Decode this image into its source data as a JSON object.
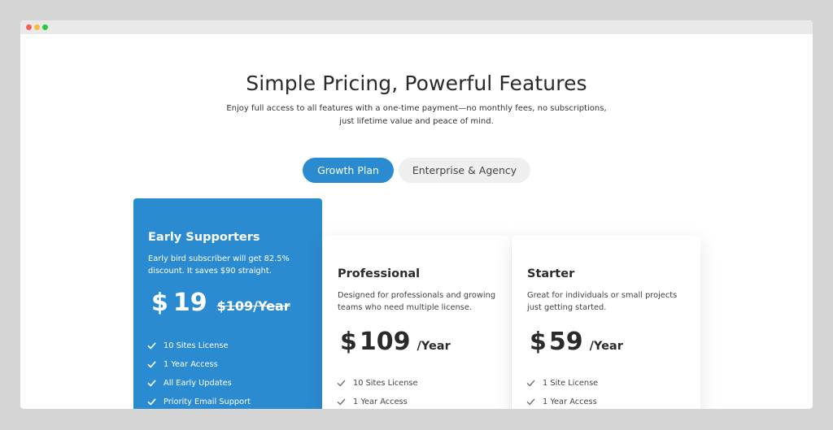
{
  "page": {
    "heading": "Simple Pricing, Powerful Features",
    "subtitle": "Enjoy full access to all features with a one-time payment—no monthly fees, no subscriptions, just lifetime value and peace of mind."
  },
  "tabs": [
    {
      "label": "Growth Plan",
      "active": true
    },
    {
      "label": "Enterprise & Agency",
      "active": false
    }
  ],
  "plans": {
    "early": {
      "title": "Early Supporters",
      "description": "Early bird subscriber will get 82.5% discount. It saves $90 straight.",
      "currency": "$",
      "price": "19",
      "old_price": "$109/Year",
      "features": [
        "10 Sites License",
        "1 Year Access",
        "All Early Updates",
        "Priority Email Support"
      ]
    },
    "professional": {
      "title": "Professional",
      "description": "Designed for professionals and growing teams who need multiple license.",
      "currency": "$",
      "price": "109",
      "period": "/Year",
      "features": [
        "10 Sites License",
        "1 Year Access"
      ]
    },
    "starter": {
      "title": "Starter",
      "description": "Great for individuals or small projects just getting started.",
      "currency": "$",
      "price": "59",
      "period": "/Year",
      "features": [
        "1 Site License",
        "1 Year Access"
      ]
    }
  },
  "colors": {
    "accent": "#2b8bd0",
    "background": "#d5d5d5",
    "tab_inactive": "#efefef"
  },
  "icons": {
    "feature_check": "check-icon"
  }
}
